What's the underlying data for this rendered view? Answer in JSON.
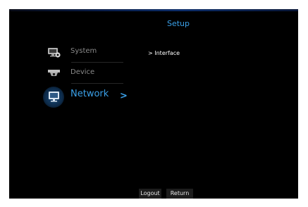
{
  "header": {
    "title": "Setup"
  },
  "menu": {
    "items": [
      {
        "label": "System",
        "icon": "monitor-gear-icon"
      },
      {
        "label": "Device",
        "icon": "camera-icon"
      },
      {
        "label": "Network",
        "icon": "network-monitor-icon",
        "selected": true
      }
    ],
    "arrow": ">"
  },
  "submenu": {
    "items": [
      {
        "label": "> Interface"
      }
    ]
  },
  "footer": {
    "logout_label": "Logout",
    "return_label": "Return"
  },
  "colors": {
    "accent": "#3aa0e8",
    "background": "#000000",
    "inactive_text": "#8a8a8a"
  }
}
